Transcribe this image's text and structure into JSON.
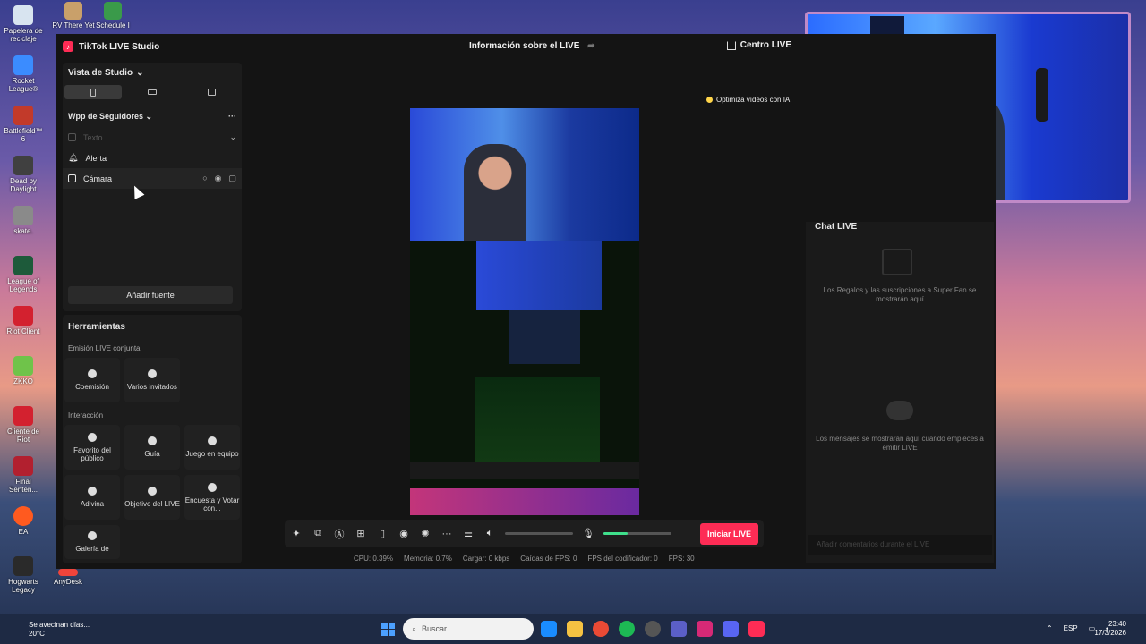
{
  "desktop": {
    "top_icons": [
      "RV There Yet",
      "Schedule I"
    ],
    "left_icons": [
      {
        "label": "Papelera de reciclaje",
        "color": "#ffffff"
      },
      {
        "label": "Rocket League®",
        "color": "#3b8cff"
      },
      {
        "label": "Battlefield™ 6",
        "color": "#c23a2a"
      },
      {
        "label": "Dead by Daylight",
        "color": "#404040"
      },
      {
        "label": "skate.",
        "color": "#8a8a8a"
      },
      {
        "label": "League of Legends",
        "color": "#1d5a3a"
      },
      {
        "label": "Riot Client",
        "color": "#d3212f"
      },
      {
        "label": "ZKKO",
        "color": "#6fc34a"
      },
      {
        "label": "Cliente de Riot",
        "color": "#d3212f"
      },
      {
        "label": "Final Senten...",
        "color": "#b2202f"
      },
      {
        "label": "EA",
        "color": "#ff5a1f"
      },
      {
        "label": "Hogwarts Legacy",
        "color": "#2a2a2a"
      }
    ],
    "anydesk": "AnyDesk"
  },
  "app": {
    "title": "TikTok LIVE Studio",
    "center_title": "Información sobre el LIVE",
    "centro_label": "Centro LIVE",
    "optimize_label": "Optimiza vídeos con IA"
  },
  "studio": {
    "view_label": "Vista de Studio",
    "scene_name": "Wpp de Seguidores",
    "sources": [
      "Texto",
      "Alerta",
      "Cámara"
    ],
    "add_source": "Añadir fuente"
  },
  "tools": {
    "title": "Herramientas",
    "section_joint": "Emisión LIVE conjunta",
    "joint": [
      "Coemisión",
      "Varios invitados"
    ],
    "section_interaction": "Interacción",
    "interaction_row1": [
      "Favorito del público",
      "Guía",
      "Juego en equipo"
    ],
    "interaction_row2": [
      "Adivina",
      "Objetivo del LIVE",
      "Encuesta y Votar con..."
    ],
    "interaction_row3": [
      "Galería de"
    ]
  },
  "toolbar": {
    "go_live": "Iniciar LIVE",
    "volume": 0,
    "mic_level": 0.35
  },
  "stats": {
    "cpu": "CPU: 0.39%",
    "memory": "Memoria: 0.7%",
    "load": "Cargar: 0 kbps",
    "fps_drop": "Caídas de FPS: 0",
    "encoder": "FPS del codificador: 0",
    "fps": "FPS: 30"
  },
  "chat": {
    "title": "Chat LIVE",
    "gifts_msg": "Los Regalos y las suscripciones a Super Fan se mostrarán aquí",
    "messages_msg": "Los mensajes se mostrarán aquí cuando empieces a emitir LIVE",
    "input_placeholder": "Añadir comentarios durante el LIVE"
  },
  "taskbar": {
    "weather_title": "Se avecinan días...",
    "weather_temp": "20°C",
    "search_placeholder": "Buscar",
    "lang": "ESP",
    "time": "23:40",
    "date": "17/3/2026"
  },
  "colors": {
    "accent": "#fe2c55",
    "mic_green": "#3fe08c"
  }
}
